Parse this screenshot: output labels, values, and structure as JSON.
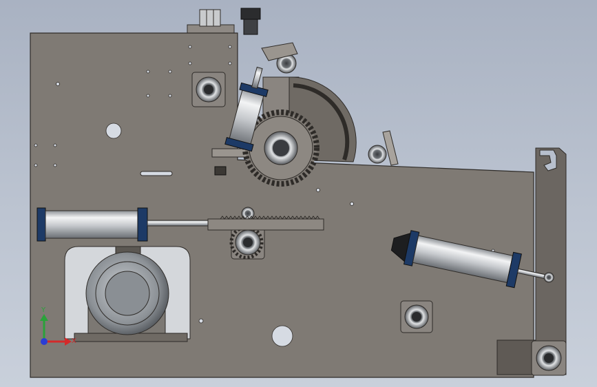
{
  "scene": {
    "type": "CAD mechanical assembly drawing (front view)",
    "colors": {
      "background_top": "#a9b2c2",
      "background_bottom": "#c9d0db",
      "plate": "#7f7a74",
      "plate_edge": "#2e2b28",
      "steel_light": "#e6e8ea",
      "steel_dark": "#4a4d52",
      "cylinder_cap": "#1d3a66",
      "bearing_block": "#8a8580",
      "motor_body": "#9ea3a8",
      "axis_x": "#d42a2a",
      "axis_y": "#2aa23a",
      "axis_origin": "#2a3dd4"
    }
  },
  "triad": {
    "x_label": "X",
    "y_label": "Y"
  }
}
